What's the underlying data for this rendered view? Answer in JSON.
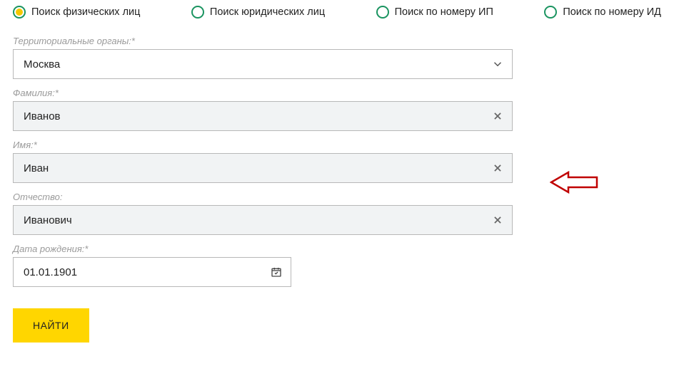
{
  "tabs": [
    {
      "label": "Поиск физических лиц",
      "selected": true
    },
    {
      "label": "Поиск юридических лиц",
      "selected": false
    },
    {
      "label": "Поиск по номеру ИП",
      "selected": false
    },
    {
      "label": "Поиск по номеру ИД",
      "selected": false
    }
  ],
  "fields": {
    "territory": {
      "label": "Территориальные органы:*",
      "value": "Москва"
    },
    "surname": {
      "label": "Фамилия:*",
      "value": "Иванов"
    },
    "name": {
      "label": "Имя:*",
      "value": "Иван"
    },
    "patronymic": {
      "label": "Отчество:",
      "value": "Иванович"
    },
    "birthdate": {
      "label": "Дата рождения:*",
      "value": "01.01.1901"
    }
  },
  "submit_label": "НАЙТИ"
}
